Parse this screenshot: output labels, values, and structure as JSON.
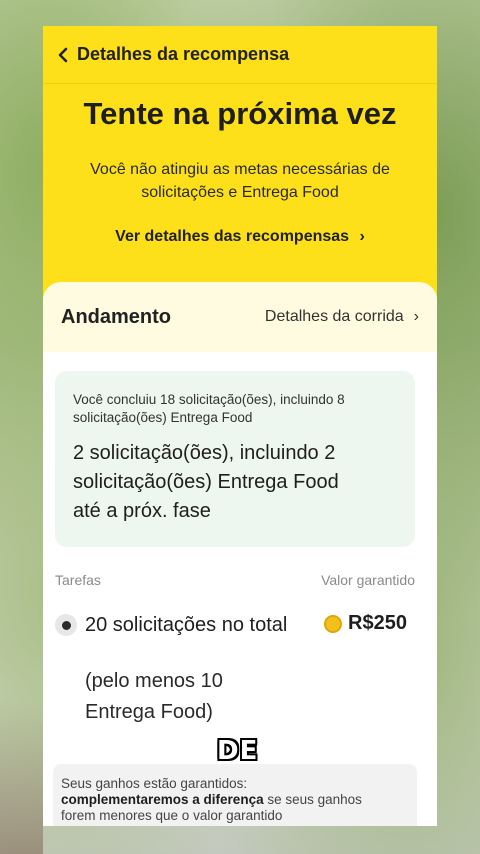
{
  "header": {
    "title": "Detalhes da recompensa"
  },
  "hero": {
    "title": "Tente na próxima vez",
    "subtitle_line1": "Você não atingiu as metas necessárias de",
    "subtitle_line2": "solicitações e Entrega Food",
    "details_link": "Ver detalhes das recompensas",
    "details_chevron": "›"
  },
  "progress": {
    "label": "Andamento",
    "ride_details_link": "Detalhes da corrida",
    "ride_details_chevron": "›"
  },
  "info": {
    "summary_line1": "Você concluiu 18 solicitação(ões), incluindo 8",
    "summary_line2": "solicitação(ões) Entrega Food",
    "remaining_line1": "2 solicitação(ões), incluindo 2",
    "remaining_line2": "solicitação(ões) Entrega Food",
    "remaining_line3": "até a próx. fase"
  },
  "tasks": {
    "header_left": "Tarefas",
    "header_right": "Valor garantido",
    "items": [
      {
        "title": "20 solicitações no total",
        "amount": "R$250",
        "detail_line1": "(pelo menos 10",
        "detail_line2": "Entrega Food)"
      }
    ]
  },
  "guarantee_note": {
    "line1": "Seus ganhos estão garantidos:",
    "bold": "complementaremos a diferença",
    "line2_rest": " se seus ganhos",
    "line3": "forem menores que o valor garantido"
  },
  "video_caption": "DE",
  "colors": {
    "brand_yellow": "#fde01a",
    "info_bg": "#edf6ef",
    "coin": "#f3c01a"
  },
  "icons": {
    "back": "chevron-left-icon",
    "coin": "coin-icon",
    "radio": "radio-selected-icon"
  }
}
